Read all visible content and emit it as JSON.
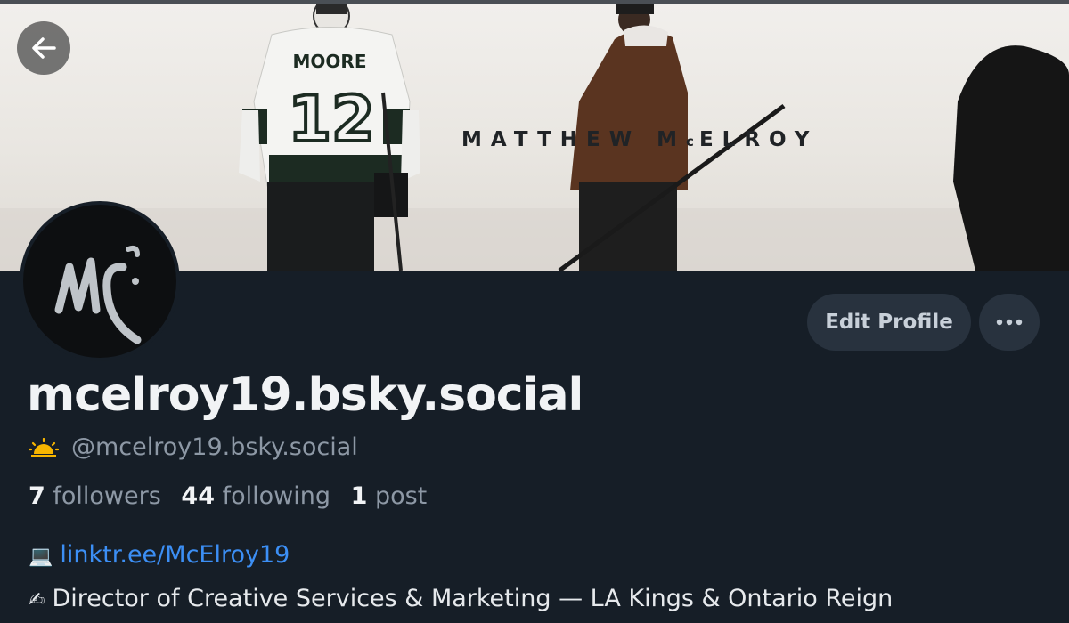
{
  "banner": {
    "title_left": "MATTHEW M",
    "title_small_c": "c",
    "title_right": "ELROY",
    "jersey_name": "MOORE",
    "jersey_number": "12"
  },
  "back_button": {
    "icon": "arrow-left-icon"
  },
  "avatar": {
    "monogram": "Mc"
  },
  "actions": {
    "edit_profile_label": "Edit Profile",
    "more_icon": "ellipsis-icon"
  },
  "profile": {
    "display_name": "mcelroy19.bsky.social",
    "handle": "@mcelroy19.bsky.social",
    "handle_emoji": "sunrise-icon"
  },
  "stats": {
    "followers_count": "7",
    "followers_label": "followers",
    "following_count": "44",
    "following_label": "following",
    "posts_count": "1",
    "posts_label": "post"
  },
  "bio": {
    "link_emoji": "💻",
    "link_text": "linktr.ee/McElroy19",
    "line2_emoji": "✍",
    "line2_text": "Director of Creative Services & Marketing — LA Kings & Ontario Reign"
  },
  "colors": {
    "background": "#161e27",
    "button_bg": "#28323e",
    "link": "#3c8ff5",
    "muted_text": "#8d98a5"
  }
}
